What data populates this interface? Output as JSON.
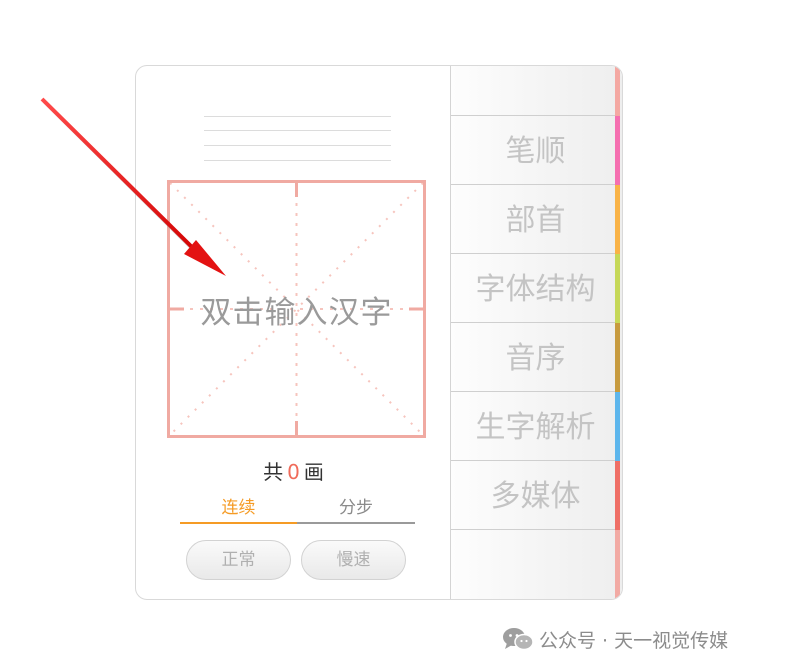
{
  "writing_panel": {
    "grid_placeholder": "双击输入汉字",
    "stroke_count": {
      "prefix": "共",
      "value": "0",
      "suffix": "画"
    },
    "mode_tabs": [
      {
        "label": "连续",
        "active": true
      },
      {
        "label": "分步",
        "active": false
      }
    ],
    "speed_buttons": [
      {
        "label": "正常"
      },
      {
        "label": "慢速"
      }
    ]
  },
  "menu": {
    "items": [
      {
        "label": "",
        "color": "#f4a8a2"
      },
      {
        "label": "笔顺",
        "color": "#f56fb0"
      },
      {
        "label": "部首",
        "color": "#f9b347"
      },
      {
        "label": "字体结构",
        "color": "#c6d858"
      },
      {
        "label": "音序",
        "color": "#c79b3f"
      },
      {
        "label": "生字解析",
        "color": "#5db6ec"
      },
      {
        "label": "多媒体",
        "color": "#ef6f66"
      },
      {
        "label": "",
        "color": "#f2aaa4"
      }
    ]
  },
  "colors": {
    "grid_border": "#f0aaa2",
    "accent_orange": "#f59b25",
    "count_red": "#f06b5a",
    "arrow": "#e31212"
  },
  "watermark": {
    "icon": "wechat-icon",
    "text": "公众号 · 天一视觉传媒"
  }
}
